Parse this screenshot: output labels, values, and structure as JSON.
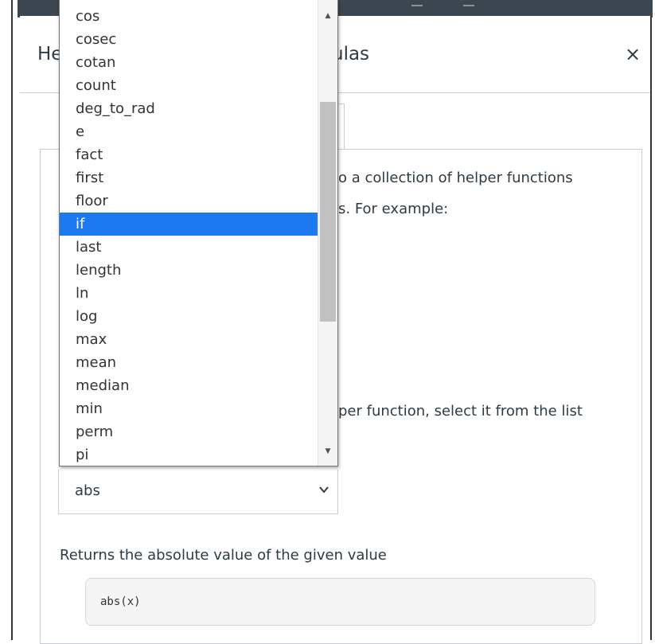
{
  "modal": {
    "title_left": "He",
    "title_right": "ulas",
    "close_glyph": "×",
    "close_icon": "close-icon"
  },
  "panel": {
    "line1": "o a collection of helper functions",
    "line2": "s. For example:",
    "line3": "per function, select it from the list"
  },
  "select": {
    "value": "abs",
    "chevron_icon": "chevron-down-icon"
  },
  "description": "Returns the absolute value of the given value",
  "code_example": "abs(x)",
  "dropdown": {
    "items": [
      "cos",
      "cosec",
      "cotan",
      "count",
      "deg_to_rad",
      "e",
      "fact",
      "first",
      "floor",
      "if",
      "last",
      "length",
      "ln",
      "log",
      "max",
      "mean",
      "median",
      "min",
      "perm",
      "pi"
    ],
    "selected": "if",
    "scroll_up_glyph": "▲",
    "scroll_down_glyph": "▼"
  },
  "colors": {
    "selected_bg": "#1e78f0",
    "text": "#2d3b45",
    "border": "#c7cdd1"
  }
}
